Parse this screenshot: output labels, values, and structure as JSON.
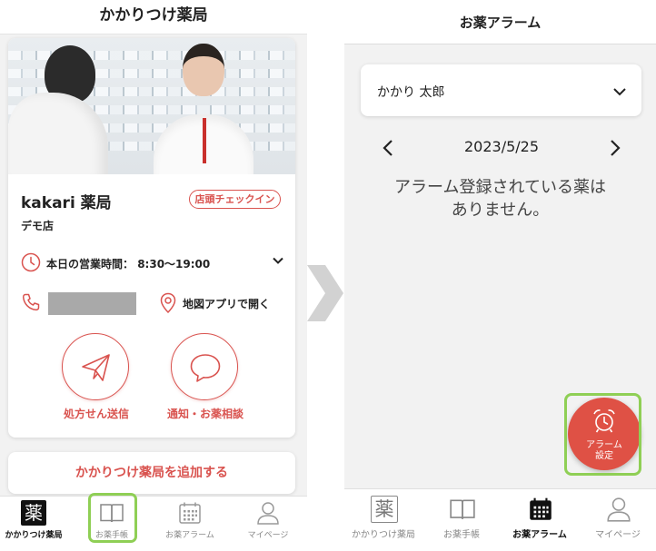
{
  "left": {
    "header_title": "かかりつけ薬局",
    "pharmacy": {
      "name": "kakari 薬局",
      "branch": "デモ店",
      "checkin_label": "店頭チェックイン",
      "hours_label": "本日の営業時間：",
      "hours_value": "8:30～19:00",
      "map_label": "地図アプリで開く"
    },
    "actions": [
      {
        "label": "処方せん送信",
        "icon": "paper-plane-icon"
      },
      {
        "label": "通知・お薬相談",
        "icon": "chat-bubble-icon"
      }
    ],
    "add_button": "かかりつけ薬局を追加する",
    "tabs": [
      {
        "label": "かかりつけ薬局",
        "icon": "kusuri-icon",
        "active": true
      },
      {
        "label": "お薬手帳",
        "icon": "book-icon",
        "active": false
      },
      {
        "label": "お薬アラーム",
        "icon": "calendar-icon",
        "active": false
      },
      {
        "label": "マイページ",
        "icon": "person-icon",
        "active": false
      }
    ]
  },
  "right": {
    "header_title": "お薬アラーム",
    "selected_person": "かかり 太郎",
    "date": "2023/5/25",
    "empty_line1": "アラーム登録されている薬は",
    "empty_line2": "ありません。",
    "fab_line1": "アラーム",
    "fab_line2": "設定",
    "tabs": [
      {
        "label": "かかりつけ薬局",
        "icon": "kusuri-icon",
        "active": false
      },
      {
        "label": "お薬手帳",
        "icon": "book-icon",
        "active": false
      },
      {
        "label": "お薬アラーム",
        "icon": "calendar-icon",
        "active": true
      },
      {
        "label": "マイページ",
        "icon": "person-icon",
        "active": false
      }
    ]
  },
  "colors": {
    "accent": "#d9534f",
    "fab": "#df5145",
    "highlight": "#8fcf55",
    "background": "#f2f2f2"
  }
}
